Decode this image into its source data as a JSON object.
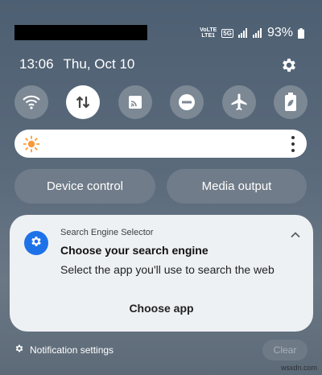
{
  "status_bar": {
    "network_label_line1": "VoLTE",
    "network_label_line2": "LTE1",
    "network_type": "5G",
    "battery_percent": "93%",
    "icons": [
      "signal-icon",
      "signal-icon",
      "battery-icon"
    ]
  },
  "header": {
    "time": "13:06",
    "date": "Thu, Oct 10",
    "settings_icon": "gear-icon"
  },
  "quick_toggles": [
    {
      "name": "wifi",
      "icon": "wifi-icon",
      "active": false
    },
    {
      "name": "mobile-data",
      "icon": "data-transfer-icon",
      "active": true
    },
    {
      "name": "cast",
      "icon": "cast-icon",
      "active": false
    },
    {
      "name": "do-not-disturb",
      "icon": "minus-circle-icon",
      "active": false
    },
    {
      "name": "airplane-mode",
      "icon": "airplane-icon",
      "active": false
    },
    {
      "name": "power-saving",
      "icon": "battery-leaf-icon",
      "active": false
    }
  ],
  "brightness": {
    "icon": "sun-icon",
    "menu_icon": "more-vertical-icon",
    "accent": "#f59a3d"
  },
  "buttons": {
    "device_control": "Device control",
    "media_output": "Media output"
  },
  "notification": {
    "app_name": "Search Engine Selector",
    "title": "Choose your search engine",
    "body": "Select the app you'll use to search the web",
    "action": "Choose app",
    "app_icon_color": "#1d72e8"
  },
  "footer": {
    "notification_settings": "Notification settings",
    "clear": "Clear"
  },
  "watermark": "wsxdn.com"
}
